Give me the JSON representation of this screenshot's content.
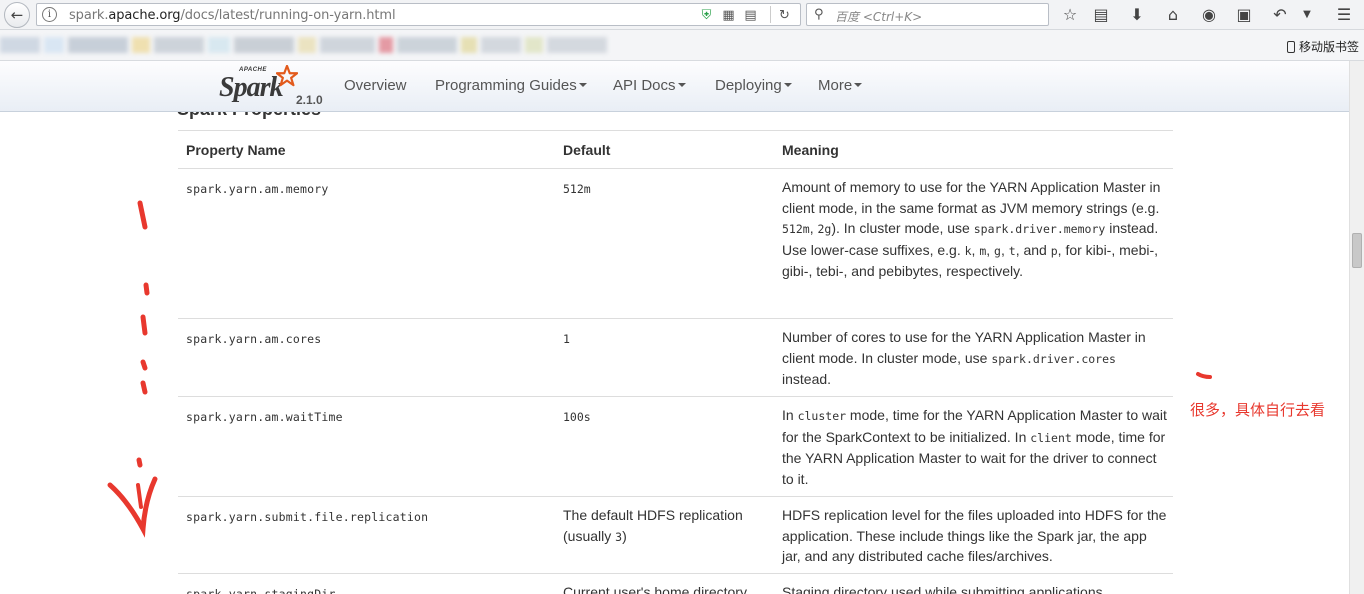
{
  "browser": {
    "url_prefix": "spark.",
    "url_domain": "apache.org",
    "url_path": "/docs/latest/running-on-yarn.html",
    "search_placeholder": "百度 <Ctrl+K>",
    "mobile_bookmarks": "移动版书签",
    "icons": [
      "back-arrow-icon",
      "info-icon",
      "shield-icon",
      "qr-code-icon",
      "reader-icon",
      "reload-icon",
      "search-icon",
      "star-icon",
      "clipboard-icon",
      "download-icon",
      "home-icon",
      "chat-icon",
      "crop-icon",
      "undo-icon",
      "dropdown-icon",
      "menu-icon"
    ]
  },
  "nav": {
    "logo_apache": "APACHE",
    "logo_spark": "Spark",
    "logo_version": "2.1.0",
    "items": [
      {
        "label": "Overview",
        "dropdown": false
      },
      {
        "label": "Programming Guides",
        "dropdown": true
      },
      {
        "label": "API Docs",
        "dropdown": true
      },
      {
        "label": "Deploying",
        "dropdown": true
      },
      {
        "label": "More",
        "dropdown": true
      }
    ]
  },
  "section_title": "Spark Properties",
  "table": {
    "headers": [
      "Property Name",
      "Default",
      "Meaning"
    ],
    "rows": [
      {
        "name": "spark.yarn.am.memory",
        "default": "512m",
        "meaning_1": "Amount of memory to use for the YARN Application Master in client mode, in the same format as JVM memory strings (e.g. ",
        "code_a": "512m",
        "sep_a": ", ",
        "code_b": "2g",
        "meaning_2": "). In cluster mode, use ",
        "code_c": "spark.driver.memory",
        "meaning_3": " instead.",
        "meaning_4": "Use lower-case suffixes, e.g. ",
        "suf_k": "k",
        "suf_m": "m",
        "suf_g": "g",
        "suf_t": "t",
        "suf_p": "p",
        "meaning_5": ", for kibi-, mebi-, gibi-, tebi-, and pebibytes, respectively."
      },
      {
        "name": "spark.yarn.am.cores",
        "default": "1",
        "meaning_1": "Number of cores to use for the YARN Application Master in client mode. In cluster mode, use ",
        "code_a": "spark.driver.cores",
        "meaning_2": " instead."
      },
      {
        "name": "spark.yarn.am.waitTime",
        "default": "100s",
        "meaning_0": "In ",
        "code_a": "cluster",
        "meaning_1": " mode, time for the YARN Application Master to wait for the SparkContext to be initialized. In ",
        "code_b": "client",
        "meaning_2": " mode, time for the YARN Application Master to wait for the driver to connect to it."
      },
      {
        "name": "spark.yarn.submit.file.replication",
        "default_1": "The default HDFS replication (usually ",
        "default_code": "3",
        "default_2": ")",
        "meaning_1": "HDFS replication level for the files uploaded into HDFS for the application. These include things like the Spark jar, the app jar, and any distributed cache files/archives."
      },
      {
        "name": "spark.yarn.stagingDir",
        "default": "Current user's home directory",
        "meaning_1": "Staging directory used while submitting applications."
      }
    ]
  },
  "annotation": {
    "note": "很多，具体自行去看",
    "color": "#e8382e"
  }
}
